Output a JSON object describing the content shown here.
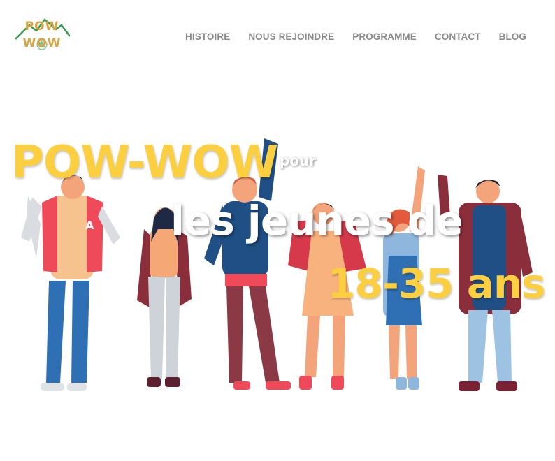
{
  "header": {
    "logo": {
      "top": "POW",
      "bottom": "WOW"
    },
    "nav": [
      "HISTOIRE",
      "NOUS REJOINDRE",
      "PROGRAMME",
      "CONTACT",
      "BLOG"
    ]
  },
  "hero": {
    "brand": "POW-WOW",
    "pour": "pour",
    "line2": "les jeunes de",
    "line3": "18-35 ans"
  },
  "colors": {
    "accent_yellow": "#fbcf3f",
    "nav_gray": "#8a8a8a",
    "logo_green": "#3a9b4e",
    "logo_gold": "#d9a441"
  },
  "icons": {
    "logo": "mountain-logo-icon",
    "hand": "waving-hand-icon"
  }
}
